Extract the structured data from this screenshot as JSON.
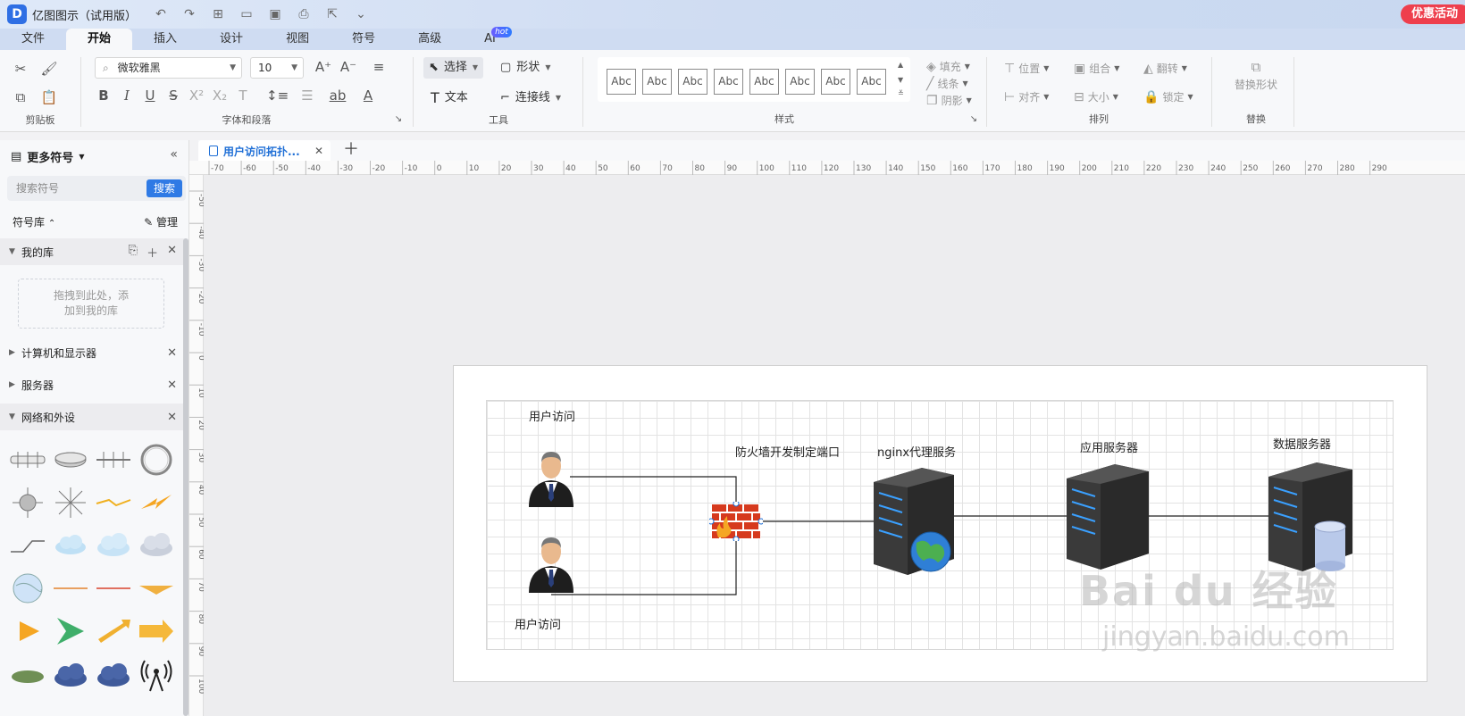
{
  "app": {
    "title": "亿图图示（试用版）",
    "promo_label": "优惠活动"
  },
  "menu": {
    "tabs": [
      "文件",
      "开始",
      "插入",
      "设计",
      "视图",
      "符号",
      "高级",
      "AI"
    ],
    "active_index": 1,
    "ai_badge": "hot"
  },
  "ribbon": {
    "clipboard_label": "剪贴板",
    "font_name": "微软雅黑",
    "font_size": "10",
    "font_group_label": "字体和段落",
    "select_label": "选择",
    "shape_label": "形状",
    "text_label": "文本",
    "connector_label": "连接线",
    "tools_label": "工具",
    "style_preview": "Abc",
    "fill_label": "填充",
    "line_label": "线条",
    "shadow_label": "阴影",
    "styles_label": "样式",
    "position_label": "位置",
    "group_label": "组合",
    "flip_label": "翻转",
    "align_label": "对齐",
    "size_label": "大小",
    "lock_label": "锁定",
    "arrange_label": "排列",
    "replace_shape_label": "替换形状",
    "replace_label": "替换"
  },
  "sidebar": {
    "title": "更多符号",
    "search_placeholder": "搜索符号",
    "search_button": "搜索",
    "library_label": "符号库",
    "manage_label": "管理",
    "my_library": "我的库",
    "drop_hint_line1": "拖拽到此处，添",
    "drop_hint_line2": "加到我的库",
    "categories": [
      "计算机和显示器",
      "服务器",
      "网络和外设"
    ]
  },
  "document": {
    "tab_title": "用户访问拓扑..."
  },
  "ruler": {
    "h_ticks": [
      "-70",
      "-60",
      "-50",
      "-40",
      "-30",
      "-20",
      "-10",
      "0",
      "10",
      "20",
      "30",
      "40",
      "50",
      "60",
      "70",
      "80",
      "90",
      "100",
      "110",
      "120",
      "130",
      "140",
      "150",
      "160",
      "170",
      "180",
      "190",
      "200",
      "210",
      "220",
      "230",
      "240",
      "250",
      "260",
      "270",
      "280",
      "290"
    ],
    "v_ticks": [
      "-50",
      "-40",
      "-30",
      "-20",
      "-10",
      "0",
      "10",
      "20",
      "30",
      "40",
      "50",
      "60",
      "70",
      "80",
      "90",
      "100"
    ]
  },
  "diagram": {
    "user_top_label": "用户访问",
    "user_bottom_label": "用户访问",
    "firewall_label": "防火墙开发制定端口",
    "nginx_label": "nginx代理服务",
    "app_server_label": "应用服务器",
    "db_server_label": "数据服务器"
  },
  "watermark": {
    "brand": "Bai du 经验",
    "url": "jingyan.baidu.com"
  },
  "colors": {
    "accent": "#2f7ae5",
    "promo": "#ee3f4d",
    "title_bar": "#cfdcf2"
  }
}
